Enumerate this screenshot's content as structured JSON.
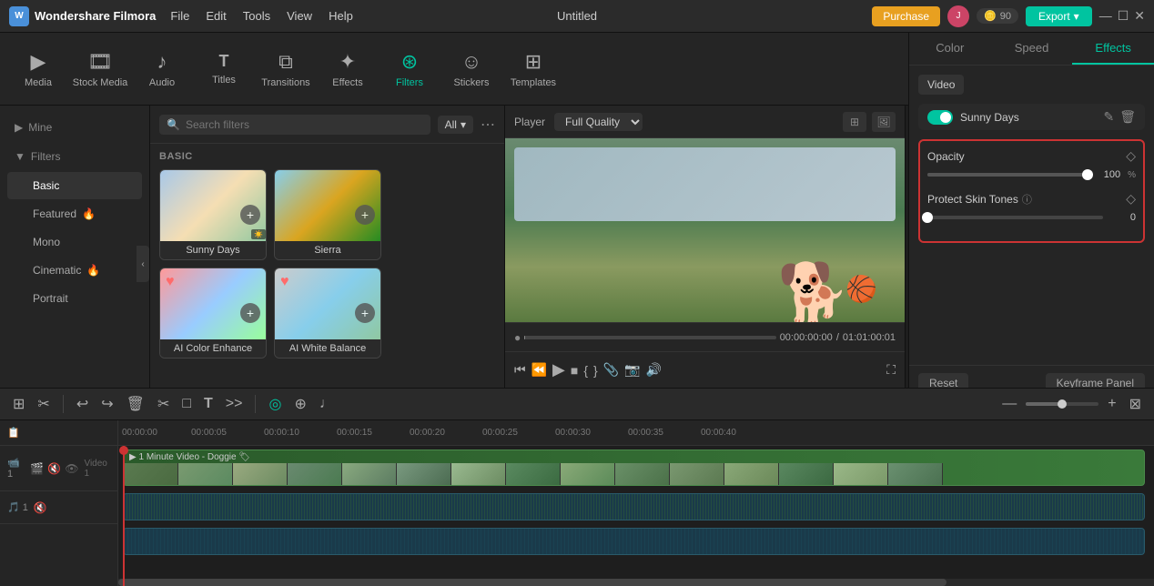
{
  "app": {
    "name": "Wondershare Filmora",
    "title": "Untitled",
    "logo_letter": "W"
  },
  "topbar": {
    "menu": [
      "File",
      "Edit",
      "Tools",
      "View",
      "Help"
    ],
    "purchase_label": "Purchase",
    "export_label": "Export",
    "export_arrow": "▾",
    "avatar_letter": "J",
    "points_icon": "🪙",
    "points_value": "90",
    "win_min": "—",
    "win_max": "☐",
    "win_close": "✕"
  },
  "toolbar": {
    "items": [
      {
        "id": "media",
        "icon": "▶",
        "label": "Media"
      },
      {
        "id": "stock",
        "icon": "🎬",
        "label": "Stock Media"
      },
      {
        "id": "audio",
        "icon": "♪",
        "label": "Audio"
      },
      {
        "id": "titles",
        "icon": "T",
        "label": "Titles"
      },
      {
        "id": "transitions",
        "icon": "⧉",
        "label": "Transitions"
      },
      {
        "id": "effects",
        "icon": "✦",
        "label": "Effects"
      },
      {
        "id": "filters",
        "icon": "⊛",
        "label": "Filters",
        "active": true
      },
      {
        "id": "stickers",
        "icon": "☺",
        "label": "Stickers"
      },
      {
        "id": "templates",
        "icon": "⊞",
        "label": "Templates"
      }
    ]
  },
  "sidebar": {
    "mine_label": "Mine",
    "filters_label": "Filters",
    "items": [
      {
        "id": "basic",
        "label": "Basic",
        "active": true
      },
      {
        "id": "featured",
        "label": "Featured",
        "fire": true
      },
      {
        "id": "mono",
        "label": "Mono"
      },
      {
        "id": "cinematic",
        "label": "Cinematic",
        "fire": true
      },
      {
        "id": "portrait",
        "label": "Portrait"
      }
    ]
  },
  "filters": {
    "search_placeholder": "Search filters",
    "all_label": "All",
    "section_label": "BASIC",
    "cards": [
      {
        "id": "sunny-days",
        "label": "Sunny Days",
        "thumb_class": "thumb-sunny",
        "has_heart": false
      },
      {
        "id": "sierra",
        "label": "Sierra",
        "thumb_class": "thumb-sierra",
        "has_heart": false
      },
      {
        "id": "ai-color",
        "label": "AI Color Enhance",
        "thumb_class": "thumb-ai-color",
        "has_heart": true
      },
      {
        "id": "ai-white",
        "label": "AI White Balance",
        "thumb_class": "thumb-ai-white",
        "has_heart": true
      }
    ]
  },
  "preview": {
    "label": "Player",
    "quality": "Full Quality",
    "current_time": "00:00:00:00",
    "separator": "/",
    "total_time": "01:01:00:01"
  },
  "right_panel": {
    "tabs": [
      "Color",
      "Speed",
      "Effects"
    ],
    "active_tab": "Effects",
    "video_label": "Video",
    "filter_name": "Sunny Days",
    "opacity_label": "Opacity",
    "opacity_value": "100",
    "opacity_unit": "%",
    "skin_tones_label": "Protect Skin Tones",
    "skin_tones_value": "0",
    "left_arrow": "◀",
    "reset_label": "Reset",
    "keyframe_label": "Keyframe Panel"
  },
  "bottom_toolbar": {
    "tools": [
      {
        "icon": "⊞",
        "name": "scenes"
      },
      {
        "icon": "✂",
        "name": "cut"
      },
      {
        "icon": "|",
        "name": "div1"
      },
      {
        "icon": "↩",
        "name": "undo"
      },
      {
        "icon": "↪",
        "name": "redo"
      },
      {
        "icon": "🗑",
        "name": "delete"
      },
      {
        "icon": "✂",
        "name": "split"
      },
      {
        "icon": "□",
        "name": "crop"
      },
      {
        "icon": "T",
        "name": "text"
      },
      {
        "icon": "↻",
        "name": "rotate"
      },
      {
        "icon": "◈",
        "name": "speed"
      },
      {
        "icon": "|",
        "name": "div2"
      },
      {
        "icon": "◎",
        "name": "record"
      },
      {
        "icon": "⊕",
        "name": "add"
      },
      {
        "icon": "♩",
        "name": "audio"
      }
    ]
  },
  "timeline": {
    "markers": [
      "00:00:00",
      "00:00:05",
      "00:00:10",
      "00:00:15",
      "00:00:20",
      "00:00:25",
      "00:00:30",
      "00:00:35",
      "00:00:40"
    ],
    "video_track_label": "1 Minute Video - Doggie",
    "track1_label": "Video 1",
    "track2_label": ""
  }
}
